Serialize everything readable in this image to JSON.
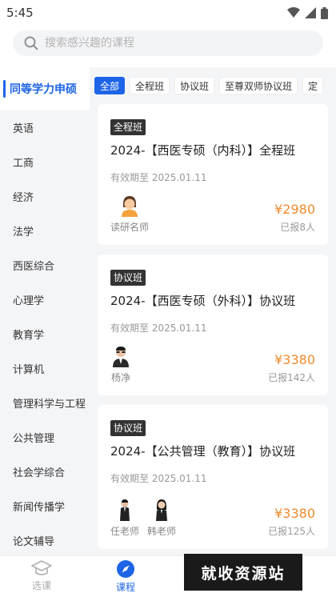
{
  "status_bar": {
    "time": "5:45",
    "icons": [
      "wifi-icon",
      "signal-icon",
      "battery-icon"
    ]
  },
  "search": {
    "placeholder": "搜索感兴趣的课程"
  },
  "sidebar": {
    "active": "同等学力申硕",
    "items": [
      "英语",
      "工商",
      "经济",
      "法学",
      "西医综合",
      "心理学",
      "教育学",
      "计算机",
      "管理科学与工程",
      "公共管理",
      "社会学综合",
      "新闻传播学",
      "论文辅导"
    ]
  },
  "filters": [
    "全部",
    "全程班",
    "协议班",
    "至尊双师协议班",
    "定"
  ],
  "courses": [
    {
      "tag": "全程班",
      "title": "2024-【西医专硕（内科）】全程班",
      "validity": "有效期至 2025.01.11",
      "teachers": [
        "读研名师"
      ],
      "price": "¥2980",
      "enrolled": "已报8人"
    },
    {
      "tag": "协议班",
      "title": "2024-【西医专硕（外科）】协议班",
      "validity": "有效期至 2025.01.11",
      "teachers": [
        "杨净"
      ],
      "price": "¥3380",
      "enrolled": "已报142人"
    },
    {
      "tag": "协议班",
      "title": "2024-【公共管理（教育）】协议班",
      "validity": "有效期至 2025.01.11",
      "teachers": [
        "任老师",
        "韩老师"
      ],
      "price": "¥3380",
      "enrolled": "已报125人"
    }
  ],
  "bottom_nav": [
    {
      "label": "选课",
      "icon": "graduation-cap-icon",
      "active": false
    },
    {
      "label": "课程",
      "icon": "compass-icon",
      "active": true
    }
  ],
  "watermark": "就收资源站",
  "colors": {
    "accent": "#1e64e6",
    "price": "#ee8a2d",
    "tag_bg": "#333333"
  }
}
